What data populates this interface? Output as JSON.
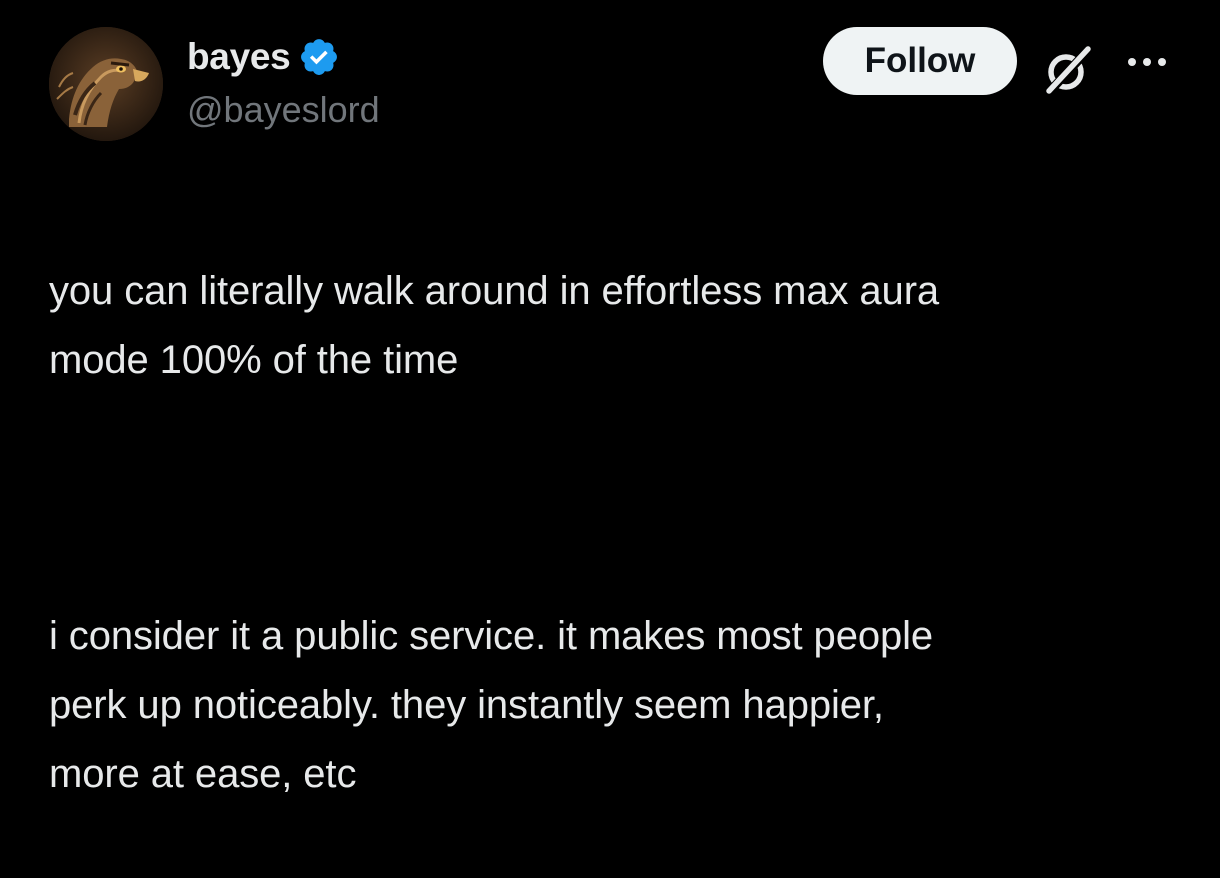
{
  "author": {
    "display_name": "bayes",
    "handle": "@bayeslord",
    "verified": true,
    "avatar_icon": "eagle-avatar"
  },
  "actions": {
    "follow_label": "Follow",
    "grok_icon": "grok-icon",
    "more_icon": "more-options-icon"
  },
  "tweet": {
    "paragraph_1": "you can literally walk around in effortless max aura\nmode 100% of the time",
    "paragraph_2": "i consider it a public service. it makes most people\nperk up noticeably. they instantly seem happier,\nmore at ease, etc"
  },
  "colors": {
    "background": "#000000",
    "text_primary": "#e7e9ea",
    "text_secondary": "#71767b",
    "verified_blue": "#1d9bf0",
    "follow_bg": "#eff3f4"
  }
}
